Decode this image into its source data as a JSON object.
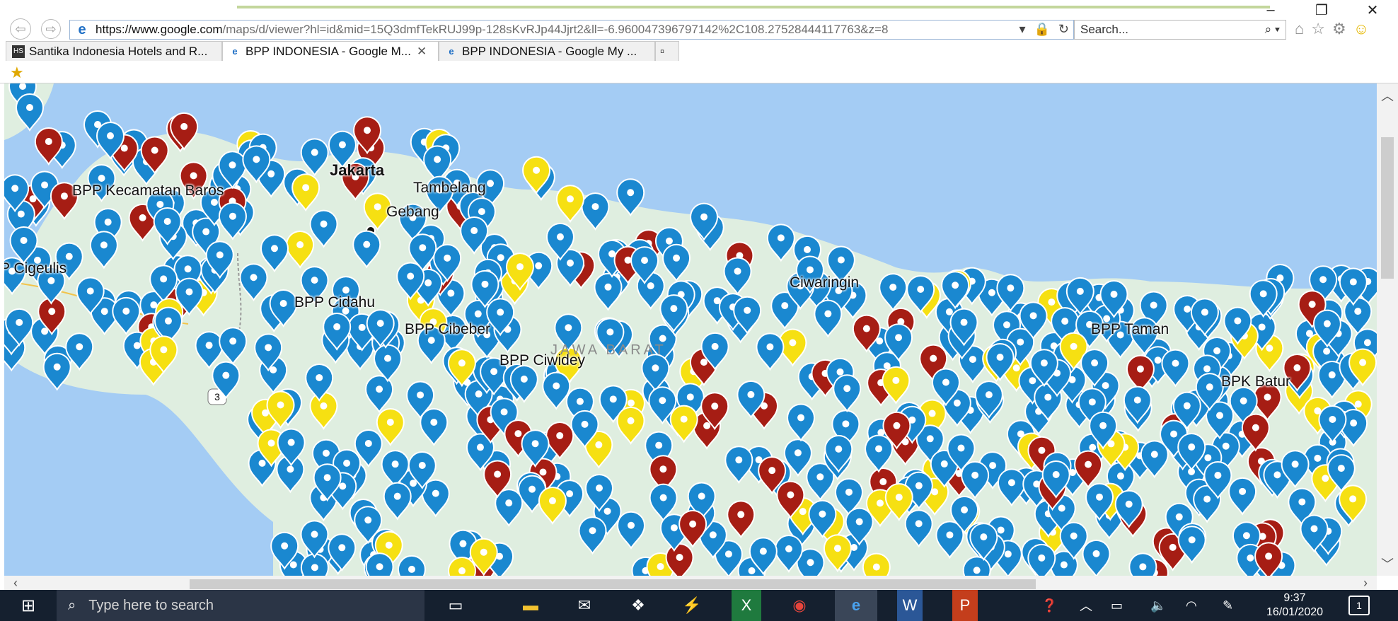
{
  "browser": {
    "url_prefix": "https://www.google.com",
    "url_rest": "/maps/d/viewer?hl=id&mid=15Q3dmfTekRUJ99p-128sKvRJp44Jjrt2&ll=-6.960047396797142%2C108.27528444117763&z=8",
    "search_placeholder": "Search...",
    "window_controls": [
      "–",
      "❐",
      "✕"
    ]
  },
  "tabs": [
    {
      "label": "Santika Indonesia Hotels and R...",
      "favicon": "santika-favicon",
      "active": false
    },
    {
      "label": "BPP INDONESIA - Google M...",
      "favicon": "ie-favicon",
      "active": true,
      "close": "✕"
    },
    {
      "label": "BPP INDONESIA - Google My ...",
      "favicon": "ie-favicon",
      "active": false
    }
  ],
  "map": {
    "colors": {
      "sea": "#a4ccf4",
      "land": "#dfeee0",
      "pin_blue": "#1a88d0",
      "pin_red": "#a61d14",
      "pin_yellow": "#f6e012"
    },
    "labels": [
      {
        "id": "baros",
        "text": "BPP Kecamatan Baros"
      },
      {
        "id": "jakarta",
        "text": "Jakarta"
      },
      {
        "id": "tambelang",
        "text": "Tambelang"
      },
      {
        "id": "gebang",
        "text": "Gebang"
      },
      {
        "id": "cigeulis",
        "text": "P Cigeulis"
      },
      {
        "id": "cidahu",
        "text": "BPP Cidahu"
      },
      {
        "id": "cibeber",
        "text": "BPP Cibeber"
      },
      {
        "id": "ciwidey",
        "text": "BPP Ciwidey"
      },
      {
        "id": "ciwaringin",
        "text": "Ciwaringin"
      },
      {
        "id": "taman",
        "text": "BPP Taman"
      },
      {
        "id": "batur",
        "text": "BPK Batur"
      },
      {
        "id": "jawabarat",
        "text": "JAWA BARAT"
      }
    ],
    "road_shield": "3"
  },
  "taskbar": {
    "search_placeholder": "Type here to search",
    "time": "9:37",
    "date": "16/01/2020",
    "notification_count": "1"
  }
}
